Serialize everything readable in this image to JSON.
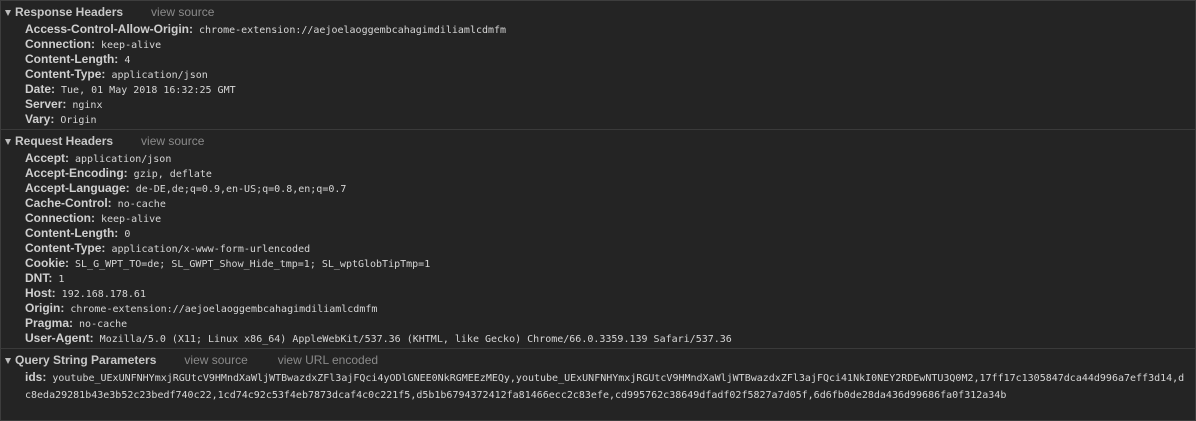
{
  "response_headers": {
    "title": "Response Headers",
    "view_source": "view source",
    "rows": [
      {
        "key": "Access-Control-Allow-Origin:",
        "value": "chrome-extension://aejoelaoggembcahagimdiliamlcdmfm"
      },
      {
        "key": "Connection:",
        "value": "keep-alive"
      },
      {
        "key": "Content-Length:",
        "value": "4"
      },
      {
        "key": "Content-Type:",
        "value": "application/json"
      },
      {
        "key": "Date:",
        "value": "Tue, 01 May 2018 16:32:25 GMT"
      },
      {
        "key": "Server:",
        "value": "nginx"
      },
      {
        "key": "Vary:",
        "value": "Origin"
      }
    ]
  },
  "request_headers": {
    "title": "Request Headers",
    "view_source": "view source",
    "rows": [
      {
        "key": "Accept:",
        "value": "application/json"
      },
      {
        "key": "Accept-Encoding:",
        "value": "gzip, deflate"
      },
      {
        "key": "Accept-Language:",
        "value": "de-DE,de;q=0.9,en-US;q=0.8,en;q=0.7"
      },
      {
        "key": "Cache-Control:",
        "value": "no-cache"
      },
      {
        "key": "Connection:",
        "value": "keep-alive"
      },
      {
        "key": "Content-Length:",
        "value": "0"
      },
      {
        "key": "Content-Type:",
        "value": "application/x-www-form-urlencoded"
      },
      {
        "key": "Cookie:",
        "value": "SL_G_WPT_TO=de; SL_GWPT_Show_Hide_tmp=1; SL_wptGlobTipTmp=1"
      },
      {
        "key": "DNT:",
        "value": "1"
      },
      {
        "key": "Host:",
        "value": "192.168.178.61"
      },
      {
        "key": "Origin:",
        "value": "chrome-extension://aejoelaoggembcahagimdiliamlcdmfm"
      },
      {
        "key": "Pragma:",
        "value": "no-cache"
      },
      {
        "key": "User-Agent:",
        "value": "Mozilla/5.0 (X11; Linux x86_64) AppleWebKit/537.36 (KHTML, like Gecko) Chrome/66.0.3359.139 Safari/537.36"
      }
    ]
  },
  "query_string": {
    "title": "Query String Parameters",
    "view_source": "view source",
    "view_url_encoded": "view URL encoded",
    "rows": [
      {
        "key": "ids:",
        "value": "youtube_UExUNFNHYmxjRGUtcV9HMndXaWljWTBwazdxZFl3ajFQci4yODlGNEE0NkRGMEEzMEQy,youtube_UExUNFNHYmxjRGUtcV9HMndXaWljWTBwazdxZFl3ajFQci41NkI0NEY2RDEwNTU3Q0M2,17ff17c1305847dca44d996a7eff3d14,dc8eda29281b43e3b52c23bedf740c22,1cd74c92c53f4eb7873dcaf4c0c221f5,d5b1b6794372412fa81466ecc2c83efe,cd995762c38649dfadf02f5827a7d05f,6d6fb0de28da436d99686fa0f312a34b"
      }
    ]
  }
}
